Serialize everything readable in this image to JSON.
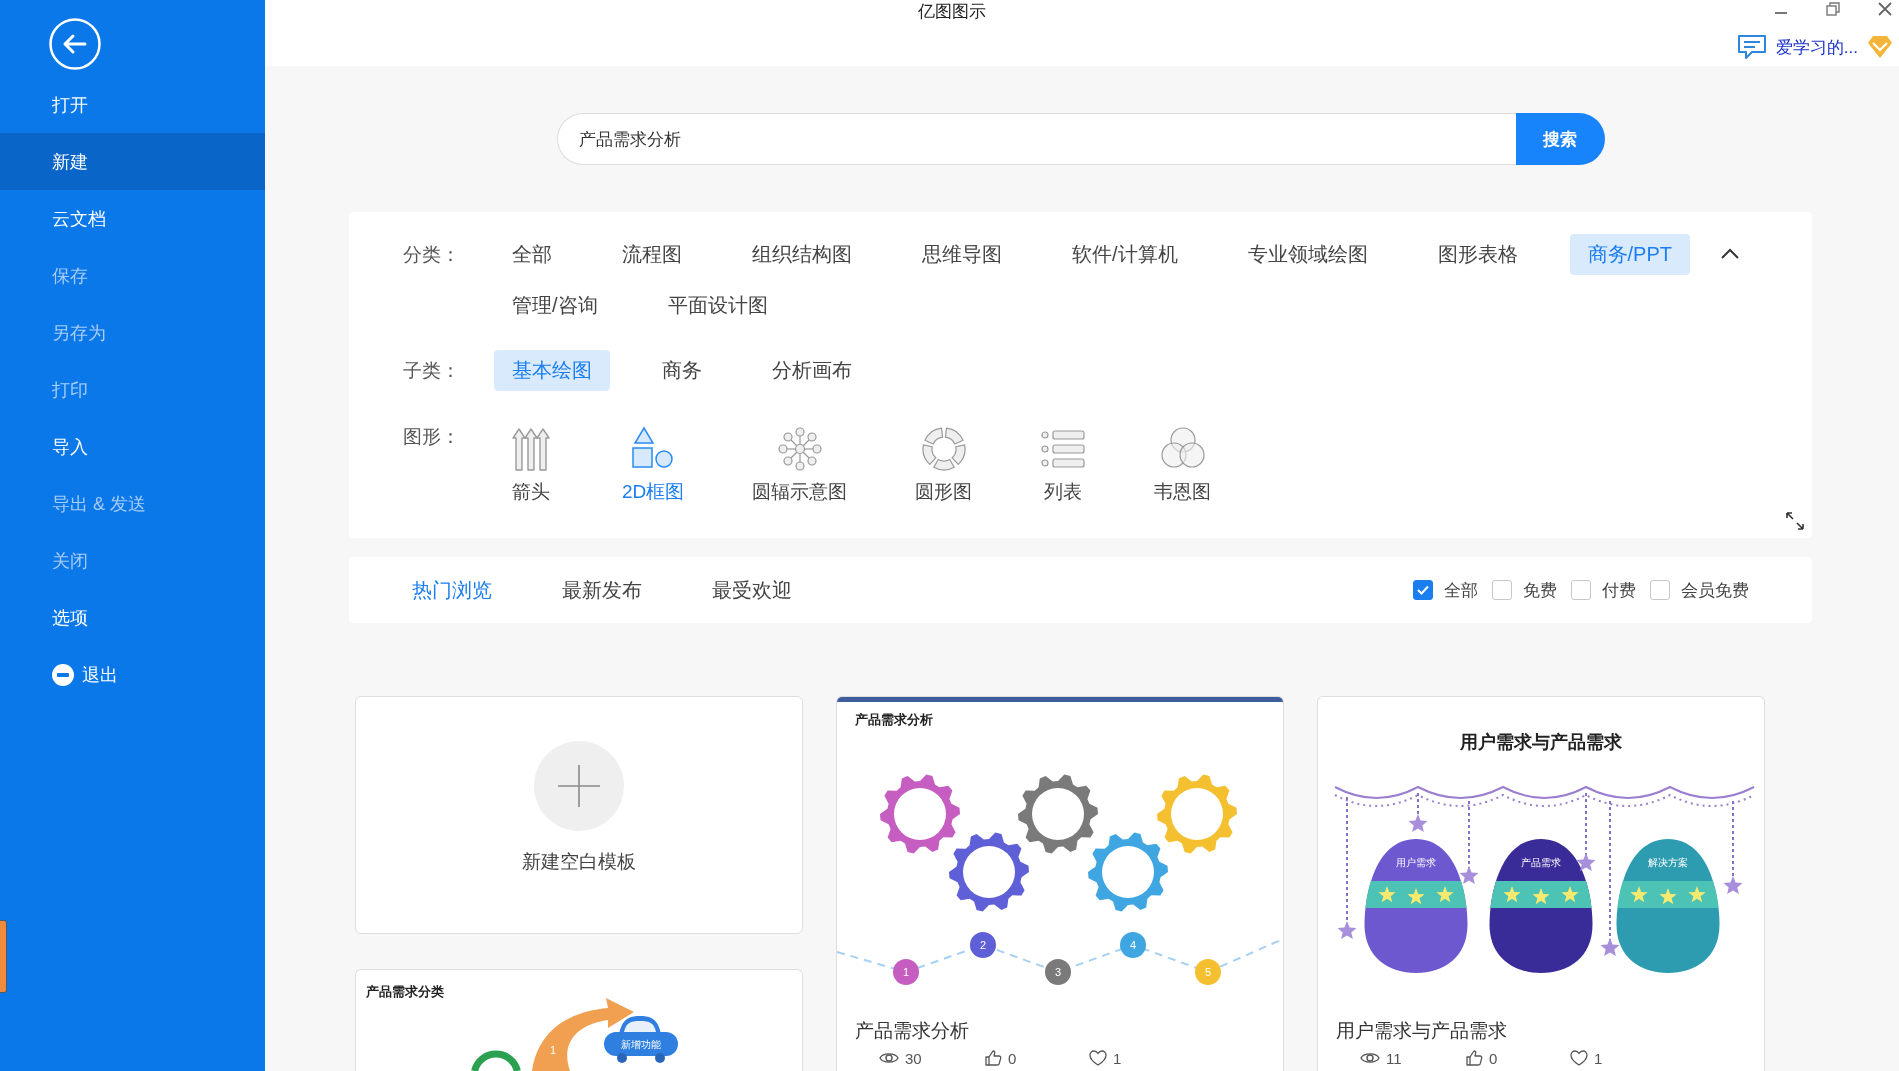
{
  "window": {
    "title": "亿图图示",
    "user_name": "爱学习的..."
  },
  "sidebar": {
    "items": [
      {
        "label": "打开",
        "selected": false,
        "disabled": false,
        "kind": "plain"
      },
      {
        "label": "新建",
        "selected": true,
        "disabled": false,
        "kind": "plain"
      },
      {
        "label": "云文档",
        "selected": false,
        "disabled": false,
        "kind": "plain"
      },
      {
        "label": "保存",
        "selected": false,
        "disabled": true,
        "kind": "plain"
      },
      {
        "label": "另存为",
        "selected": false,
        "disabled": true,
        "kind": "plain"
      },
      {
        "label": "打印",
        "selected": false,
        "disabled": true,
        "kind": "plain"
      },
      {
        "label": "导入",
        "selected": false,
        "disabled": false,
        "kind": "plain"
      },
      {
        "label": "导出 & 发送",
        "selected": false,
        "disabled": true,
        "kind": "plain"
      },
      {
        "label": "关闭",
        "selected": false,
        "disabled": true,
        "kind": "plain"
      },
      {
        "label": "选项",
        "selected": false,
        "disabled": false,
        "kind": "plain"
      },
      {
        "label": "退出",
        "selected": false,
        "disabled": false,
        "kind": "exit"
      }
    ]
  },
  "search": {
    "value": "产品需求分析",
    "button": "搜索"
  },
  "filters": {
    "category": {
      "label": "分类：",
      "options": [
        {
          "label": "全部",
          "selected": false
        },
        {
          "label": "流程图",
          "selected": false
        },
        {
          "label": "组织结构图",
          "selected": false
        },
        {
          "label": "思维导图",
          "selected": false
        },
        {
          "label": "软件/计算机",
          "selected": false
        },
        {
          "label": "专业领域绘图",
          "selected": false
        },
        {
          "label": "图形表格",
          "selected": false
        },
        {
          "label": "商务/PPT",
          "selected": true
        },
        {
          "label": "管理/咨询",
          "selected": false
        },
        {
          "label": "平面设计图",
          "selected": false
        }
      ]
    },
    "subcategory": {
      "label": "子类：",
      "options": [
        {
          "label": "基本绘图",
          "selected": true
        },
        {
          "label": "商务",
          "selected": false
        },
        {
          "label": "分析画布",
          "selected": false
        }
      ]
    },
    "shape": {
      "label": "图形：",
      "options": [
        {
          "label": "箭头",
          "selected": false,
          "kind": "arrows"
        },
        {
          "label": "2D框图",
          "selected": true,
          "kind": "blocks"
        },
        {
          "label": "圆辐示意图",
          "selected": false,
          "kind": "radial"
        },
        {
          "label": "圆形图",
          "selected": false,
          "kind": "cycle"
        },
        {
          "label": "列表",
          "selected": false,
          "kind": "list"
        },
        {
          "label": "韦恩图",
          "selected": false,
          "kind": "venn"
        }
      ]
    }
  },
  "sort_tabs": [
    {
      "label": "热门浏览",
      "selected": true
    },
    {
      "label": "最新发布",
      "selected": false
    },
    {
      "label": "最受欢迎",
      "selected": false
    }
  ],
  "price_filters": [
    {
      "label": "全部",
      "checked": true
    },
    {
      "label": "免费",
      "checked": false
    },
    {
      "label": "付费",
      "checked": false
    },
    {
      "label": "会员免费",
      "checked": false
    }
  ],
  "templates": [
    {
      "kind": "blank",
      "label": "新建空白模板"
    },
    {
      "kind": "gears",
      "title": "产品需求分析",
      "thumbnail": {
        "heading": "产品需求分析",
        "steps": [
          {
            "label": "1",
            "color": "#c55ec0"
          },
          {
            "label": "2",
            "color": "#5f5fd8"
          },
          {
            "label": "3",
            "color": "#7a7a7a"
          },
          {
            "label": "4",
            "color": "#3fa6e2"
          },
          {
            "label": "5",
            "color": "#f5c02f"
          }
        ]
      },
      "stats": {
        "views": "30",
        "likes": "0",
        "favorites": "1"
      }
    },
    {
      "kind": "eggs",
      "title": "用户需求与产品需求",
      "thumbnail": {
        "heading": "用户需求与产品需求",
        "eggs": [
          {
            "label": "用户需求",
            "color": "#6d58d0"
          },
          {
            "label": "产品需求",
            "color": "#3a2c98"
          },
          {
            "label": "解决方案",
            "color": "#2e9cb0"
          }
        ]
      },
      "stats": {
        "views": "11",
        "likes": "0",
        "favorites": "1"
      }
    },
    {
      "kind": "flow",
      "thumbnail": {
        "heading": "产品需求分类",
        "arrow_label": "1",
        "car_label": "新增功能"
      }
    }
  ]
}
